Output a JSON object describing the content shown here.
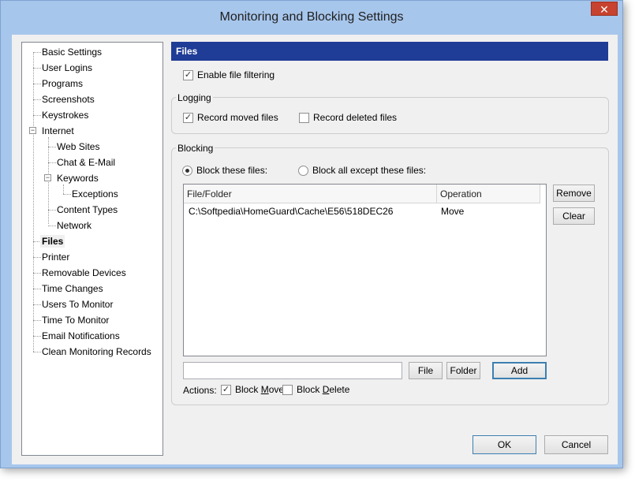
{
  "window": {
    "title": "Monitoring and Blocking Settings",
    "close_glyph": "✕"
  },
  "tree": {
    "items": [
      {
        "label": "Basic Settings",
        "level": 0
      },
      {
        "label": "User Logins",
        "level": 0
      },
      {
        "label": "Programs",
        "level": 0
      },
      {
        "label": "Screenshots",
        "level": 0
      },
      {
        "label": "Keystrokes",
        "level": 0
      },
      {
        "label": "Internet",
        "level": 0,
        "expanded": true
      },
      {
        "label": "Web Sites",
        "level": 1
      },
      {
        "label": "Chat & E-Mail",
        "level": 1
      },
      {
        "label": "Keywords",
        "level": 1,
        "expanded": true
      },
      {
        "label": "Exceptions",
        "level": 2
      },
      {
        "label": "Content Types",
        "level": 1
      },
      {
        "label": "Network",
        "level": 1
      },
      {
        "label": "Files",
        "level": 0,
        "selected": true
      },
      {
        "label": "Printer",
        "level": 0
      },
      {
        "label": "Removable Devices",
        "level": 0
      },
      {
        "label": "Time Changes",
        "level": 0
      },
      {
        "label": "Users To Monitor",
        "level": 0
      },
      {
        "label": "Time To Monitor",
        "level": 0
      },
      {
        "label": "Email Notifications",
        "level": 0
      },
      {
        "label": "Clean Monitoring Records",
        "level": 0
      }
    ],
    "expander_glyph": "−"
  },
  "files": {
    "header": "Files",
    "enable_filtering": {
      "label": "Enable file filtering",
      "checked": true
    },
    "logging": {
      "label": "Logging",
      "record_moved": {
        "label": "Record moved files",
        "checked": true
      },
      "record_deleted": {
        "label": "Record deleted files",
        "checked": false
      }
    },
    "blocking": {
      "label": "Blocking",
      "block_these": {
        "label": "Block these files:",
        "selected": true
      },
      "block_all_except": {
        "label": "Block all except these files:",
        "selected": false
      },
      "columns": [
        "File/Folder",
        "Operation"
      ],
      "rows": [
        {
          "path": "C:\\Softpedia\\HomeGuard\\Cache\\E56\\518DEC26",
          "operation": "Move"
        }
      ],
      "remove_label": "Remove",
      "clear_label": "Clear",
      "path_input_value": "",
      "file_label": "File",
      "folder_label": "Folder",
      "add_label": "Add",
      "actions_label": "Actions:",
      "block_move": {
        "label_pre": "Block ",
        "label_ul": "M",
        "label_post": "ove",
        "checked": true
      },
      "block_delete": {
        "label_pre": "Block ",
        "label_ul": "D",
        "label_post": "elete",
        "checked": false
      }
    }
  },
  "footer": {
    "ok_label": "OK",
    "cancel_label": "Cancel"
  },
  "check_glyph": "✓"
}
